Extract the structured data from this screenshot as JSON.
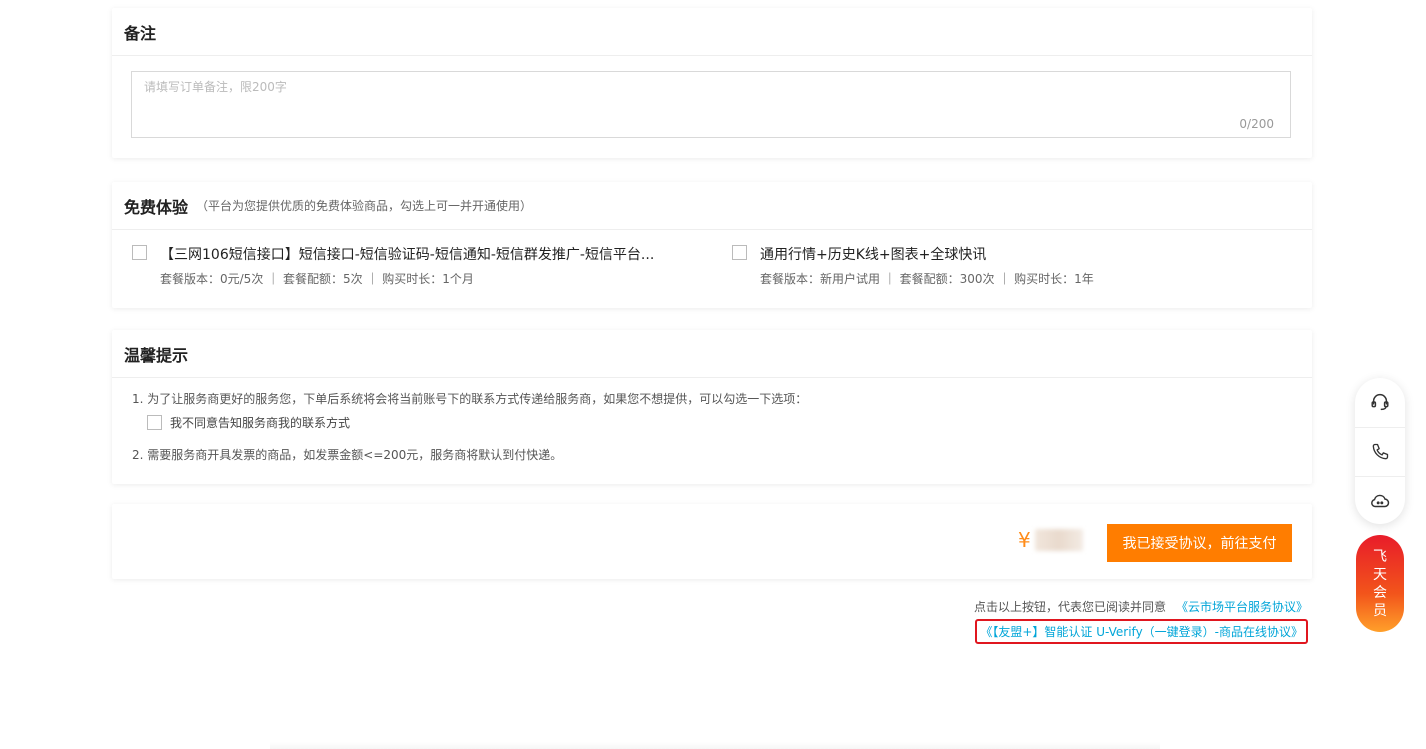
{
  "remark": {
    "title": "备注",
    "placeholder": "请填写订单备注，限200字",
    "count": "0/200"
  },
  "free": {
    "title": "免费体验",
    "subtitle": "（平台为您提供优质的免费体验商品，勾选上可一并开通使用）",
    "items": [
      {
        "name": "【三网106短信接口】短信接口-短信验证码-短信通知-短信群发推广-短信平台...",
        "spec": "套餐版本：0元/5次 ｜ 套餐配额：5次 ｜ 购买时长：1个月"
      },
      {
        "name": "通用行情+历史K线+图表+全球快讯",
        "spec": "套餐版本：新用户试用 ｜ 套餐配额：300次 ｜ 购买时长：1年"
      }
    ]
  },
  "tips": {
    "title": "温馨提示",
    "line1": "1. 为了让服务商更好的服务您，下单后系统将会将当前账号下的联系方式传递给服务商，如果您不想提供，可以勾选一下选项：",
    "option": "我不同意告知服务商我的联系方式",
    "line2": "2. 需要服务商开具发票的商品，如发票金额<=200元，服务商将默认到付快递。"
  },
  "pay": {
    "currency": "¥",
    "button": "我已接受协议，前往支付"
  },
  "agreement": {
    "prefix": "点击以上按钮，代表您已阅读并同意",
    "link1": "《云市场平台服务协议》",
    "link2": "《【友盟+】智能认证 U-Verify（一键登录）-商品在线协议》"
  },
  "float": {
    "icons": [
      "headset-icon",
      "phone-icon",
      "cloud-chat-icon"
    ],
    "member": [
      "飞",
      "天",
      "会",
      "员"
    ]
  },
  "colors": {
    "accent": "#ff7d00",
    "link": "#00a5d8",
    "highlight": "#e0161f"
  }
}
